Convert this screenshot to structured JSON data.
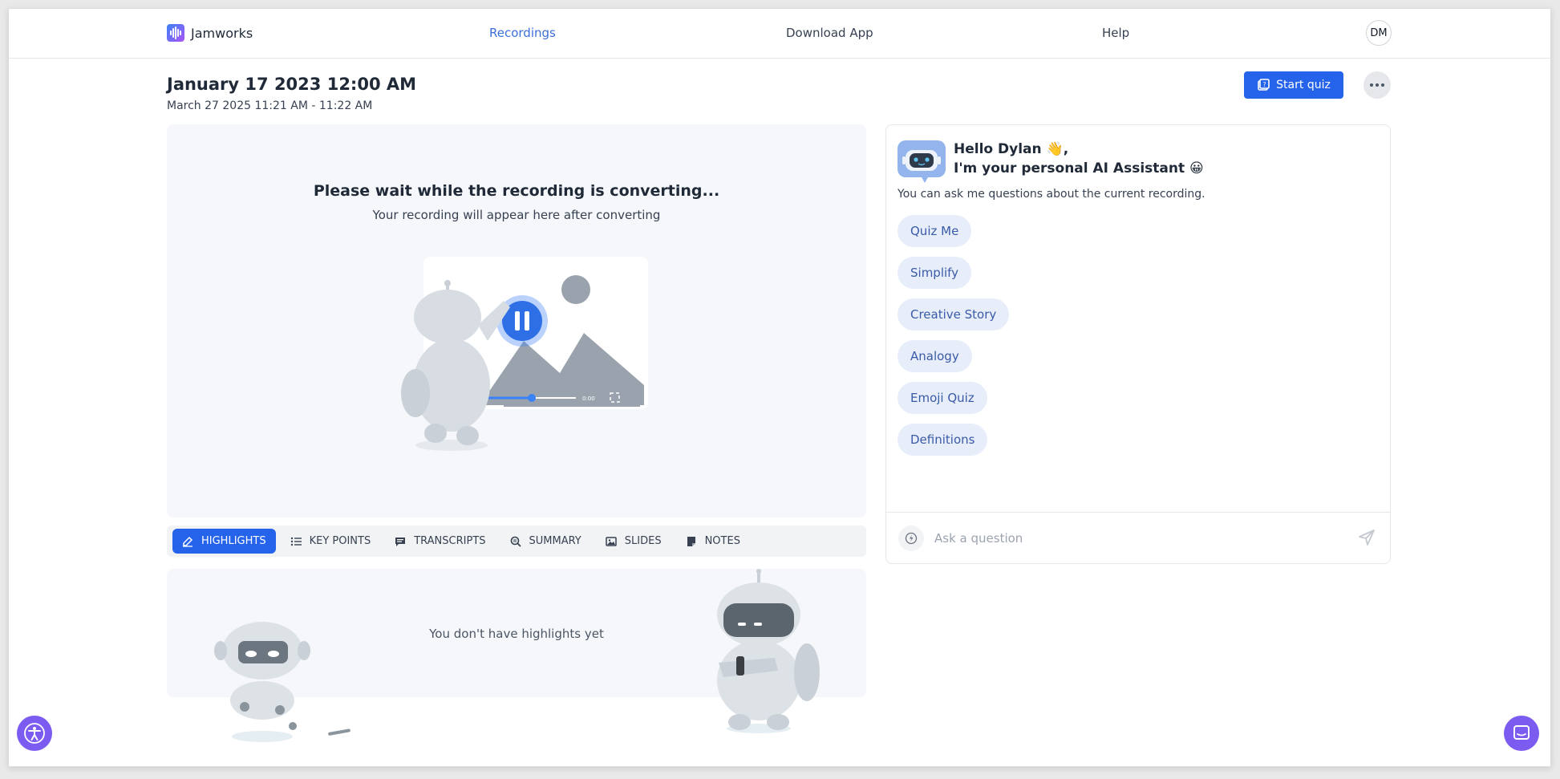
{
  "app": {
    "logo_text": "Jamworks",
    "user_initials": "DM"
  },
  "nav": {
    "recordings": "Recordings",
    "download_app": "Download App",
    "help": "Help"
  },
  "header": {
    "title": "January 17 2023 12:00 AM",
    "subtitle": "March 27 2025 11:21 AM - 11:22 AM",
    "start_quiz_label": "Start quiz"
  },
  "player": {
    "title": "Please wait while the recording is converting...",
    "subtitle": "Your recording will appear here after converting",
    "time_label": "0:00"
  },
  "tabs": [
    {
      "label": "HIGHLIGHTS",
      "icon": "highlighter-icon",
      "active": true
    },
    {
      "label": "KEY POINTS",
      "icon": "list-icon",
      "active": false
    },
    {
      "label": "TRANSCRIPTS",
      "icon": "transcript-icon",
      "active": false
    },
    {
      "label": "SUMMARY",
      "icon": "search-doc-icon",
      "active": false
    },
    {
      "label": "SLIDES",
      "icon": "image-icon",
      "active": false
    },
    {
      "label": "NOTES",
      "icon": "note-icon",
      "active": false
    }
  ],
  "highlights": {
    "empty_text": "You don't have highlights yet"
  },
  "assistant": {
    "greeting_line1": "Hello Dylan 👋,",
    "greeting_line2": "I'm your personal AI Assistant 😀",
    "description": "You can ask me questions about the current recording.",
    "chips": [
      "Quiz Me",
      "Simplify",
      "Creative Story",
      "Analogy",
      "Emoji Quiz",
      "Definitions"
    ],
    "input_placeholder": "Ask a question"
  },
  "colors": {
    "accent": "#2563eb",
    "chip_bg": "#e7edf9",
    "chip_text": "#3a5ba8",
    "floating_button": "#7c5cf0"
  }
}
